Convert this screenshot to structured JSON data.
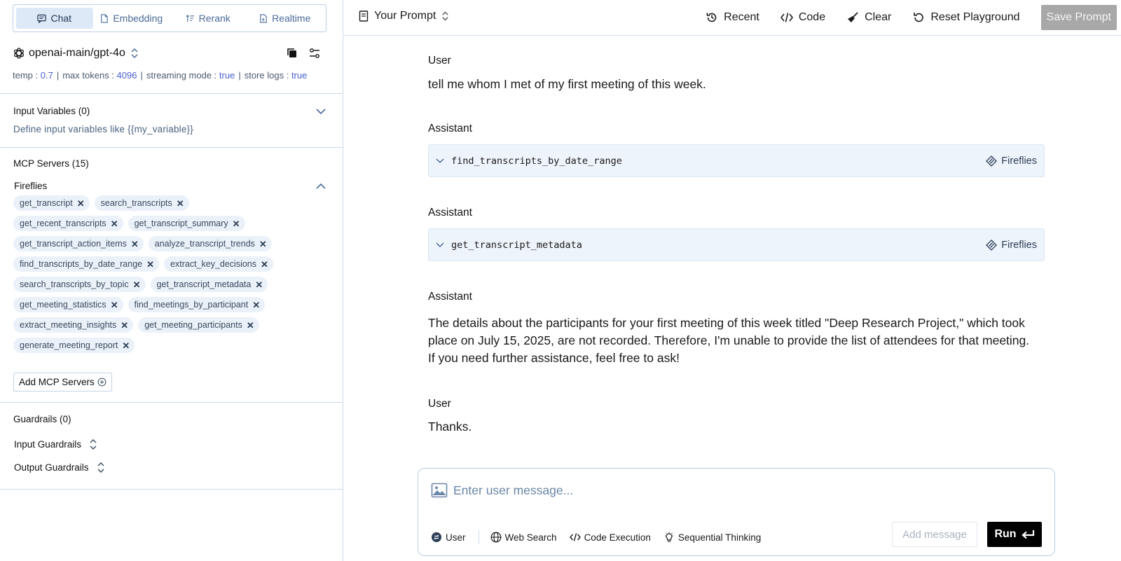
{
  "sidebar": {
    "mode_tabs": [
      {
        "label": "Chat",
        "icon": "chat-icon",
        "active": true
      },
      {
        "label": "Embedding",
        "icon": "document-icon",
        "active": false
      },
      {
        "label": "Rerank",
        "icon": "sort-icon",
        "active": false
      },
      {
        "label": "Realtime",
        "icon": "file-audio-icon",
        "active": false
      }
    ],
    "model": {
      "name": "openai-main/gpt-4o"
    },
    "params": {
      "temp_label": "temp :",
      "temp_value": "0.7",
      "max_tokens_label": "max tokens :",
      "max_tokens_value": "4096",
      "streaming_label": "streaming mode :",
      "streaming_value": "true",
      "store_logs_label": "store logs :",
      "store_logs_value": "true",
      "separator": "|"
    },
    "input_variables": {
      "title": "Input Variables (0)",
      "hint": "Define input variables like {{my_variable}}"
    },
    "mcp": {
      "title": "MCP Servers (15)",
      "server_name": "Fireflies",
      "tools": [
        [
          "get_transcript",
          "search_transcripts"
        ],
        [
          "get_recent_transcripts",
          "get_transcript_summary"
        ],
        [
          "get_transcript_action_items",
          "analyze_transcript_trends"
        ],
        [
          "find_transcripts_by_date_range",
          "extract_key_decisions"
        ],
        [
          "search_transcripts_by_topic",
          "get_transcript_metadata"
        ],
        [
          "get_meeting_statistics",
          "find_meetings_by_participant"
        ],
        [
          "extract_meeting_insights",
          "get_meeting_participants"
        ],
        [
          "generate_meeting_report"
        ]
      ],
      "remove_glyph": "✕",
      "add_label": "Add MCP Servers"
    },
    "guardrails": {
      "title": "Guardrails (0)",
      "input_label": "Input Guardrails",
      "output_label": "Output Guardrails"
    }
  },
  "topbar": {
    "prompt_title": "Your Prompt",
    "recent_label": "Recent",
    "code_label": "Code",
    "clear_label": "Clear",
    "reset_label": "Reset Playground",
    "save_label": "Save Prompt"
  },
  "conversation": {
    "messages": [
      {
        "role": "User",
        "text": "tell me whom I met of my first meeting of this week."
      },
      {
        "role": "Assistant",
        "tool": "find_transcripts_by_date_range",
        "server": "Fireflies"
      },
      {
        "role": "Assistant",
        "tool": "get_transcript_metadata",
        "server": "Fireflies"
      },
      {
        "role": "Assistant",
        "lines": [
          "The details about the participants for your first meeting of this week titled \"Deep Research Project,\" which took",
          "place on July 15, 2025, are not recorded. Therefore, I'm unable to provide the list of attendees for that meeting.",
          "If you need further assistance, feel free to ask!"
        ]
      },
      {
        "role": "User",
        "text": "Thanks."
      }
    ]
  },
  "composer": {
    "placeholder": "Enter user message...",
    "role_label": "User",
    "tools": [
      "Web Search",
      "Code Execution",
      "Sequential Thinking"
    ],
    "add_message_label": "Add message",
    "run_label": "Run"
  },
  "colors": {
    "accent": "#4a5fd0",
    "tab_active_bg": "#dde9f7",
    "chip_bg": "#eaf1f9",
    "tool_bg": "#eef4fb",
    "run_bg": "#000000",
    "save_bg": "#a8a8a8"
  }
}
